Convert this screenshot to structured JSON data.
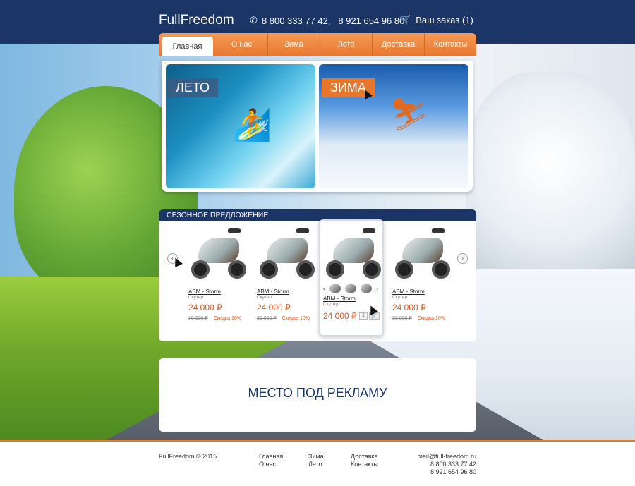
{
  "header": {
    "logo": "FullFreedom",
    "phones": "8 800 333 77 42,   8 921 654 96 80",
    "order": "Ваш заказ (1)"
  },
  "nav": {
    "tabs": [
      {
        "label": "Главная",
        "active": true
      },
      {
        "label": "О нас"
      },
      {
        "label": "Зима"
      },
      {
        "label": "Лето"
      },
      {
        "label": "Доставка"
      },
      {
        "label": "Контакты"
      }
    ]
  },
  "hero": {
    "summer_label": "ЛЕТО",
    "winter_label": "ЗИМА"
  },
  "offers": {
    "title": "СЕЗОННОЕ ПРЕДЛОЖЕНИЕ",
    "products": [
      {
        "name": "ABM - Storm",
        "type": "Скутер",
        "price": "24 000 ₽",
        "old": "30 000 ₽",
        "discount": "Скидка 10%"
      },
      {
        "name": "ABM - Storm",
        "type": "Скутер",
        "price": "24 000 ₽",
        "old": "30 000 ₽",
        "discount": "Скидка 10%"
      },
      {
        "name": "ABM - Storm",
        "type": "Скутер",
        "price": "24 000 ₽",
        "qty": "1"
      },
      {
        "name": "ABM - Storm",
        "type": "Скутер",
        "price": "24 000 ₽",
        "old": "30 000 ₽",
        "discount": "Скидка 10%"
      }
    ]
  },
  "ad": {
    "text": "МЕСТО ПОД РЕКЛАМУ"
  },
  "footer": {
    "copyright": "FullFreedom © 2015",
    "col1": [
      "Главная",
      "О нас"
    ],
    "col2": [
      "Зима",
      "Лето"
    ],
    "col3": [
      "Доставка",
      "Контакты"
    ],
    "email": "mail@full-freedom.ru",
    "phone1": "8 800 333 77 42",
    "phone2": "8 921 654 96 80"
  },
  "colors": {
    "navy": "#1b3566",
    "orange": "#e8772e",
    "price": "#e0561d"
  }
}
